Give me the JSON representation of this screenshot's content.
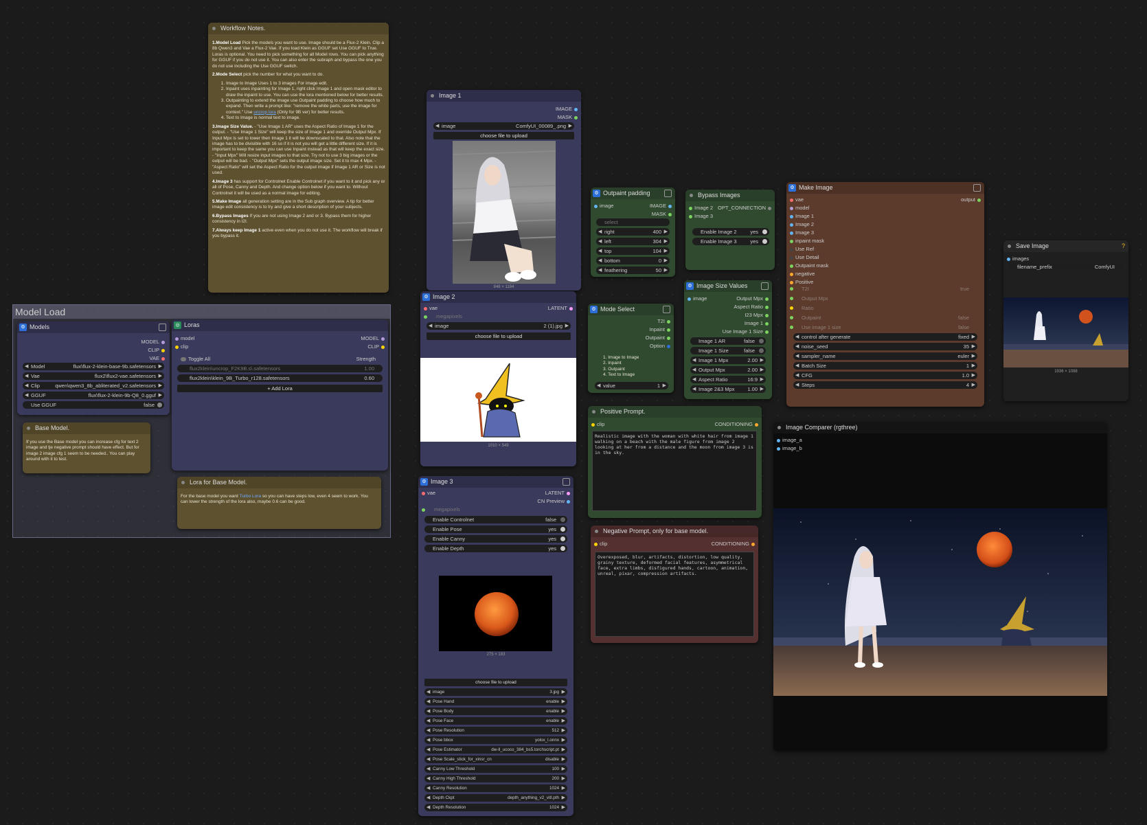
{
  "workflow_notes": {
    "title": "Workflow Notes.",
    "p1_bold": "1.Model Load",
    "p1": " Pick the models you want to use. Image should be a Flux-2 Klein. Clip a 8b Qwen3 and Vae a Flux-2 Vae. If you load Klein as GGUF set Use GGUF to True. Loras is optional. You need to pick something for all Model rows. You can pick anything for GGUF if you do not use it. You can also enter the subraph and bypass the one you do not use including the Use GGUF switch.",
    "p2_bold": "2.Mode Select",
    "p2": " pick the number for what you want to do.",
    "p2_items": [
      "Image to Image Uses 1 to 3 images For image edit.",
      "Inpaint uses inpainting for Image 1, right click Image 1 and open mask editor to draw the inpaint to use. You can use the lora mentioned below for better results.",
      "Outpainting to extend the image use Outpaint padding to choose how much to expand. Then write a prompt like: \"remove the white parts, use the image for context.\" Use",
      "Text to Image is normal text to image."
    ],
    "p2_link": "uncrop lora",
    "p2_link_after": " (Only for 9B ver) for better results.",
    "p3_bold": "3.Image Size Value.",
    "p3": " - \"Use Image 1 AR\" uses the Aspect Ratio of Image 1 for the output. - \"Use Image 1 Size\" will keep the size of Image 1 and override Output Mpx. If Input Mpx is set to lower then Image 1 it will be downscaled to that. Also note that the image has to be divisible with 16 so if it is not you will get a little different size. If it is important to keep the same you can use Inpaint instead as that will keep the exact size. - \"Input Mpx\" Will resize input images to that size. Try not to use 3 big images or the output will be bad. - \"Output Mpx\" sets the output image size. Set it to max 4 Mpx. - \"Aspect Ratio\" will set the Aspect Ratio for the output image if Image 1 AR or Size is not used.",
    "p4_bold": "4.Image 3",
    "p4": " has support for Controlnet Enable Controlnet if you want to it and pick any or all of Pose, Canny and Depth. And change option below if you want to. Without Controlnet it will be used as a normal image for editing.",
    "p5_bold": "5.Make Image",
    "p5": " all generation setting are in the Sub graph overview. A tip for better image edit consistency is to try and give a short description of your subjects.",
    "p6_bold": "6.Bypass Images",
    "p6": " If you are not using Image 2 and or 3. Bypass them for higher consistency in I2I.",
    "p7_bold": "7.Always keep Image 1",
    "p7": " active even when you do not use it. The workflow will break if you bypass it."
  },
  "model_load_group": {
    "title": "Model Load"
  },
  "models": {
    "title": "Models",
    "outputs": [
      "MODEL",
      "CLIP",
      "VAE"
    ],
    "widgets": [
      {
        "label": "Model",
        "value": "flux\\flux-2-klein-base-9b.safetensors"
      },
      {
        "label": "Vae",
        "value": "flux2\\flux2-vae.safetensors"
      },
      {
        "label": "Clip",
        "value": "qwen\\qwen3_8b_abliterated_v2.safetensors"
      },
      {
        "label": "GGUF",
        "value": "flux\\flux-2-klein-9b-Q8_0.gguf"
      }
    ],
    "use_gguf": {
      "label": "Use GGUF",
      "value": "false"
    }
  },
  "loras": {
    "title": "Loras",
    "inputs": [
      "model",
      "clip"
    ],
    "outputs": [
      "MODEL",
      "CLIP"
    ],
    "toggle_all": "Toggle All",
    "strength": "Strength",
    "items": [
      {
        "name": "flux2klein\\uncrop_F2K9B.s\\.safetensors",
        "value": "1.00"
      },
      {
        "name": "flux2klein\\klein_9B_Turbo_r128.safetensors",
        "value": "0.60"
      }
    ],
    "add_label": "+ Add Lora"
  },
  "base_model_note": {
    "title": "Base Model.",
    "text": "If you use the Base model you can increase cfg for text 2 image and tje negative prompt should have effect. But for image 2 image cfg 1 seem to be needed.. You can play around with it to test."
  },
  "lora_base_note": {
    "title": "Lora for Base Model.",
    "text_before": "For the base model you want ",
    "link": "Turbo Lora",
    "text_after": " so you can have steps low, even 4 seem to work. You can lower the strength of the lora also, maybe 0.6 can be good."
  },
  "image1": {
    "title": "Image 1",
    "outputs": [
      "IMAGE",
      "MASK"
    ],
    "image_label": "image",
    "image_value": "ComfyUI_00089_.png",
    "upload": "choose file to upload",
    "caption": "848 × 1184"
  },
  "image2": {
    "title": "Image 2",
    "input": "vae",
    "output": "LATENT",
    "megapixels": "megapixels",
    "image_label": "image",
    "image_value": "2 (1).jpg",
    "upload": "choose file to upload",
    "caption": "1010 × 549"
  },
  "image3": {
    "title": "Image 3",
    "input": "vae",
    "outputs": [
      "LATENT",
      "CN Preview"
    ],
    "megapixels": "megapixels",
    "toggles": [
      {
        "label": "Enable Controlnet",
        "value": "false"
      },
      {
        "label": "Enable Pose",
        "value": "yes"
      },
      {
        "label": "Enable Canny",
        "value": "yes"
      },
      {
        "label": "Enable Depth",
        "value": "yes"
      }
    ],
    "caption": "275 × 183",
    "upload": "choose file to upload",
    "widgets": [
      {
        "label": "image",
        "value": "3.jpg"
      },
      {
        "label": "Pose Hand",
        "value": "enable"
      },
      {
        "label": "Pose Body",
        "value": "enable"
      },
      {
        "label": "Pose Face",
        "value": "enable"
      },
      {
        "label": "Pose Resolution",
        "value": "512"
      },
      {
        "label": "Pose bbox",
        "value": "yolox_l.onnx"
      },
      {
        "label": "Pose Estimator",
        "value": "dw-ll_ucoco_384_bs5.torchscript.pt"
      },
      {
        "label": "Pose Scale_stick_for_xinsr_cn",
        "value": "disable"
      },
      {
        "label": "Canny Low Threshold",
        "value": "100"
      },
      {
        "label": "Canny High Threshold",
        "value": "200"
      },
      {
        "label": "Canny Resolution",
        "value": "1024"
      },
      {
        "label": "Depth Ckpt",
        "value": "depth_anything_v2_vitl.pth"
      },
      {
        "label": "Depth Resolution",
        "value": "1024"
      }
    ]
  },
  "outpaint": {
    "title": "Outpaint padding",
    "input": "image",
    "outputs": [
      "IMAGE",
      "MASK"
    ],
    "select": "select",
    "widgets": [
      {
        "label": "right",
        "value": "400"
      },
      {
        "label": "left",
        "value": "304"
      },
      {
        "label": "top",
        "value": "104"
      },
      {
        "label": "bottom",
        "value": "0"
      },
      {
        "label": "feathering",
        "value": "50"
      }
    ]
  },
  "bypass": {
    "title": "Bypass Images",
    "inputs": [
      "Image 2",
      "Image 3"
    ],
    "output": "OPT_CONNECTION",
    "toggles": [
      {
        "label": "Enable Image 2",
        "value": "yes"
      },
      {
        "label": "Enable Image 3",
        "value": "yes"
      }
    ]
  },
  "mode_select": {
    "title": "Mode Select",
    "outputs": [
      "T2I",
      "Inpaint",
      "Outpaint",
      "Option"
    ],
    "list": [
      "1. Image to Image",
      "2. Inpaint",
      "3. Outpaint",
      "4. Text to Image"
    ],
    "value_label": "value",
    "value": "1"
  },
  "size_values": {
    "title": "Image Size Values",
    "input": "image",
    "outputs": [
      "Output Mpx",
      "Aspect Ratio",
      "I23 Mpx",
      "Image 1",
      "Use Image 1 Size"
    ],
    "toggles": [
      {
        "label": "Image 1 AR",
        "value": "false"
      },
      {
        "label": "Image 1 Size",
        "value": "false"
      }
    ],
    "widgets": [
      {
        "label": "Image 1 Mpx",
        "value": "2.00"
      },
      {
        "label": "Output Mpx",
        "value": "2.00"
      },
      {
        "label": "Aspect Ratio",
        "value": "16:9"
      },
      {
        "label": "Image 2&3 Mpx",
        "value": "1.00"
      }
    ]
  },
  "make_image": {
    "title": "Make Image",
    "inputs": [
      "vae",
      "model",
      "Image 1",
      "Image 2",
      "Image 3",
      "inpaint mask",
      "Use Ref",
      "Use Detail",
      "Outpaint mask",
      "negative",
      "Positive"
    ],
    "output": "output",
    "faded": [
      {
        "label": "T2I",
        "value": "true"
      },
      {
        "label": "Output Mpx",
        "value": ""
      },
      {
        "label": "Ratio",
        "value": ""
      },
      {
        "label": "Outpaint",
        "value": "false"
      },
      {
        "label": "Use image 1 size",
        "value": "false"
      }
    ],
    "widgets": [
      {
        "label": "control after generate",
        "value": "fixed"
      },
      {
        "label": "noise_seed",
        "value": "35"
      },
      {
        "label": "sampler_name",
        "value": "euler"
      },
      {
        "label": "Batch Size",
        "value": "1"
      },
      {
        "label": "CFG",
        "value": "1.0"
      },
      {
        "label": "Steps",
        "value": "4"
      }
    ]
  },
  "save_image": {
    "title": "Save Image",
    "input": "images",
    "prefix_label": "filename_prefix",
    "prefix_value": "ComfyUI",
    "caption": "1936 × 1088"
  },
  "positive": {
    "title": "Positive Prompt.",
    "input": "clip",
    "output": "CONDITIONING",
    "text": "Realistic image with the woman with white hair from image 1 walking on a beach with the male figure from image 2 looking at her from a distance and the moon from image 3 is in the sky."
  },
  "negative": {
    "title": "Negative Prompt, only for base model.",
    "input": "clip",
    "output": "CONDITIONING",
    "text": "Overexposed, blur, artifacts, distortion, low quality, grainy texture, deformed facial features, asymmetrical face, extra limbs, disfigured hands, cartoon, animation, unreal, pixar, compression artifacts."
  },
  "comparer": {
    "title": "Image Comparer (rgthree)",
    "inputs": [
      "image_a",
      "image_b"
    ]
  },
  "colors": {
    "model": "#b39ddb",
    "clip": "#ffd500",
    "vae": "#ff6e6e",
    "image": "#64b5f6",
    "latent": "#ff9cf9",
    "conditioning": "#ffa931",
    "int": "#7dd35f"
  }
}
